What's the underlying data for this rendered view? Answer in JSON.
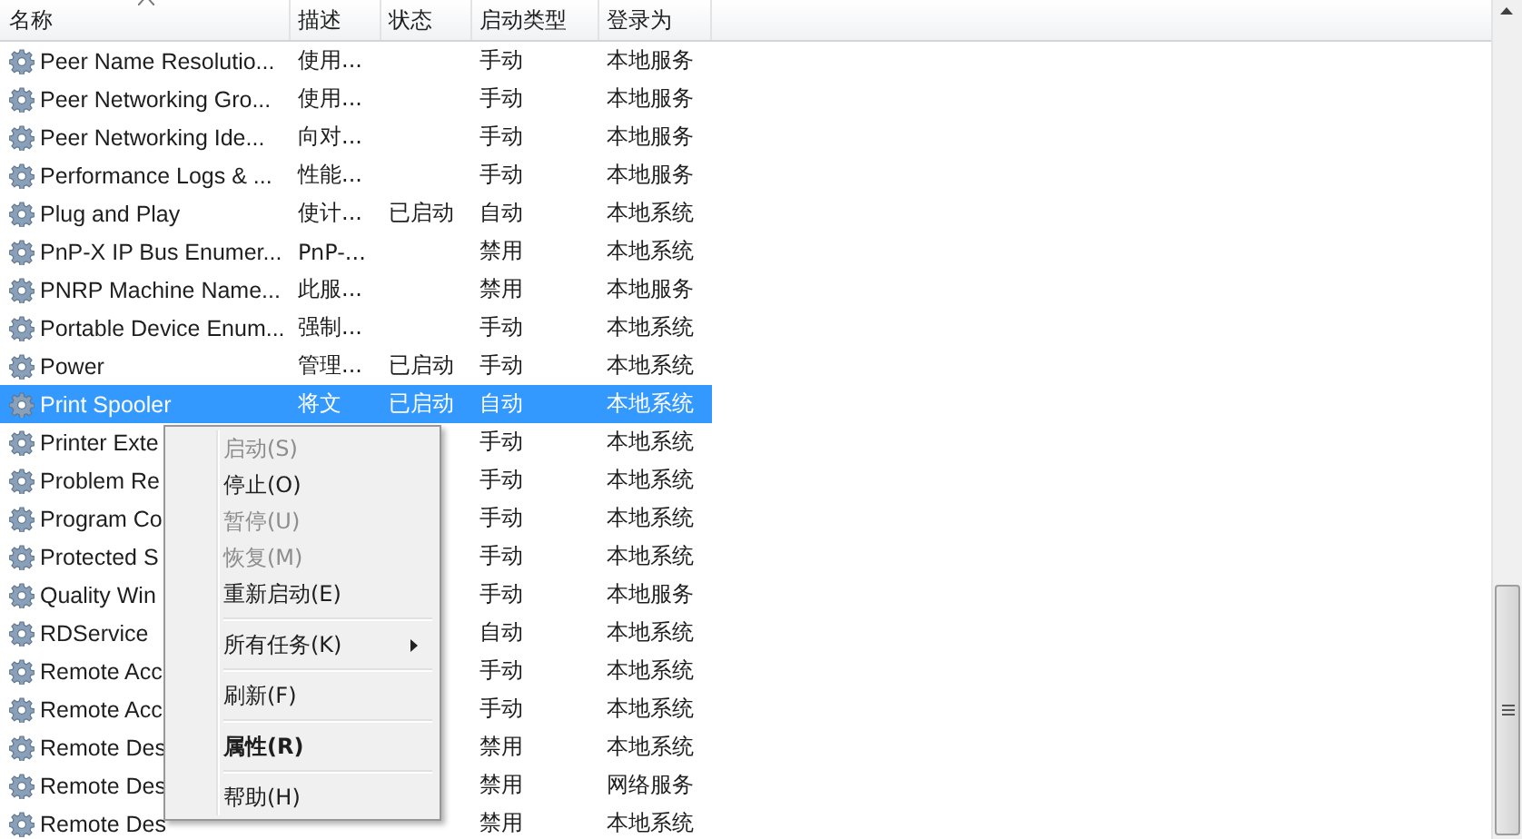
{
  "table": {
    "columns": [
      "名称",
      "描述",
      "状态",
      "启动类型",
      "登录为"
    ],
    "rows": [
      {
        "name": "Peer Name Resolutio...",
        "description": "使用...",
        "status": "",
        "startup": "手动",
        "logon": "本地服务",
        "selected": false
      },
      {
        "name": "Peer Networking Gro...",
        "description": "使用...",
        "status": "",
        "startup": "手动",
        "logon": "本地服务",
        "selected": false
      },
      {
        "name": "Peer Networking Ide...",
        "description": "向对...",
        "status": "",
        "startup": "手动",
        "logon": "本地服务",
        "selected": false
      },
      {
        "name": "Performance Logs & ...",
        "description": "性能...",
        "status": "",
        "startup": "手动",
        "logon": "本地服务",
        "selected": false
      },
      {
        "name": "Plug and Play",
        "description": "使计...",
        "status": "已启动",
        "startup": "自动",
        "logon": "本地系统",
        "selected": false
      },
      {
        "name": "PnP-X IP Bus Enumer...",
        "description": "PnP-...",
        "status": "",
        "startup": "禁用",
        "logon": "本地系统",
        "selected": false
      },
      {
        "name": "PNRP Machine Name...",
        "description": "此服...",
        "status": "",
        "startup": "禁用",
        "logon": "本地服务",
        "selected": false
      },
      {
        "name": "Portable Device Enum...",
        "description": "强制...",
        "status": "",
        "startup": "手动",
        "logon": "本地系统",
        "selected": false
      },
      {
        "name": "Power",
        "description": "管理...",
        "status": "已启动",
        "startup": "手动",
        "logon": "本地系统",
        "selected": false
      },
      {
        "name": "Print Spooler",
        "description": "将文",
        "status": "已启动",
        "startup": "自动",
        "logon": "本地系统",
        "selected": true
      },
      {
        "name": "Printer Exte",
        "description": "",
        "status": "",
        "startup": "手动",
        "logon": "本地系统",
        "selected": false
      },
      {
        "name": "Problem Re",
        "description": "",
        "status": "",
        "startup": "手动",
        "logon": "本地系统",
        "selected": false
      },
      {
        "name": "Program Co",
        "description": "",
        "status": "",
        "startup": "手动",
        "logon": "本地系统",
        "selected": false
      },
      {
        "name": "Protected S",
        "description": "",
        "status": "",
        "startup": "手动",
        "logon": "本地系统",
        "selected": false
      },
      {
        "name": "Quality Win",
        "description": "",
        "status": "",
        "startup": "手动",
        "logon": "本地服务",
        "selected": false
      },
      {
        "name": "RDService",
        "description": "",
        "status": "",
        "startup": "自动",
        "logon": "本地系统",
        "selected": false
      },
      {
        "name": "Remote Acc",
        "description": "",
        "status": "",
        "startup": "手动",
        "logon": "本地系统",
        "selected": false
      },
      {
        "name": "Remote Acc",
        "description": "",
        "status": "",
        "startup": "手动",
        "logon": "本地系统",
        "selected": false
      },
      {
        "name": "Remote Des",
        "description": "",
        "status": "",
        "startup": "禁用",
        "logon": "本地系统",
        "selected": false
      },
      {
        "name": "Remote Des",
        "description": "",
        "status": "",
        "startup": "禁用",
        "logon": "网络服务",
        "selected": false
      },
      {
        "name": "Remote Des",
        "description": "",
        "status": "",
        "startup": "禁用",
        "logon": "本地系统",
        "selected": false
      }
    ]
  },
  "context_menu": {
    "items": [
      {
        "kind": "item",
        "label": "启动(S)",
        "disabled": true
      },
      {
        "kind": "item",
        "label": "停止(O)",
        "disabled": false
      },
      {
        "kind": "item",
        "label": "暂停(U)",
        "disabled": true
      },
      {
        "kind": "item",
        "label": "恢复(M)",
        "disabled": true
      },
      {
        "kind": "item",
        "label": "重新启动(E)",
        "disabled": false
      },
      {
        "kind": "separator"
      },
      {
        "kind": "submenu",
        "label": "所有任务(K)",
        "disabled": false
      },
      {
        "kind": "separator"
      },
      {
        "kind": "item",
        "label": "刷新(F)",
        "disabled": false
      },
      {
        "kind": "separator"
      },
      {
        "kind": "default",
        "label": "属性(R)",
        "disabled": false
      },
      {
        "kind": "separator"
      },
      {
        "kind": "item",
        "label": "帮助(H)",
        "disabled": false
      }
    ]
  }
}
